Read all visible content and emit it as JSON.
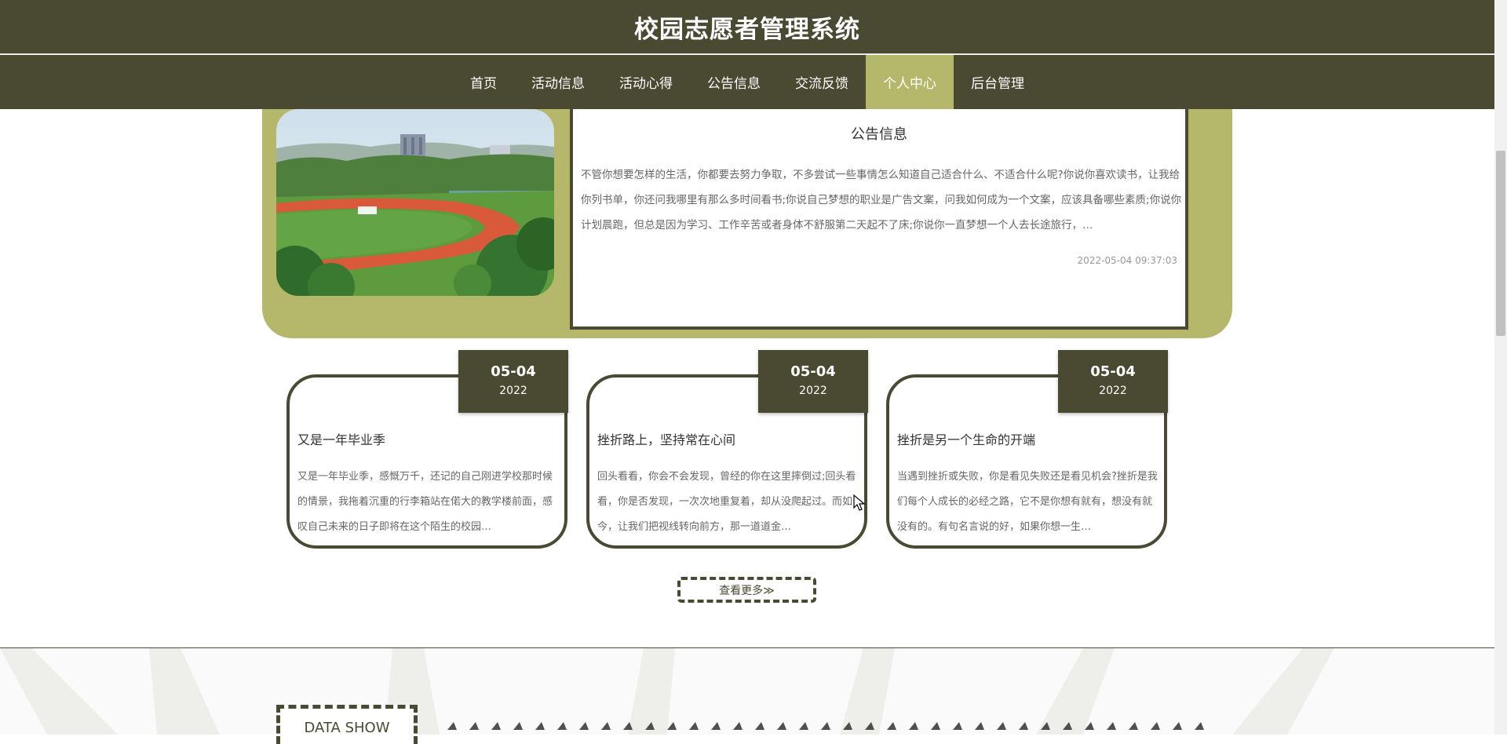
{
  "header": {
    "title": "校园志愿者管理系统"
  },
  "nav": {
    "items": [
      {
        "label": "首页"
      },
      {
        "label": "活动信息"
      },
      {
        "label": "活动心得"
      },
      {
        "label": "公告信息"
      },
      {
        "label": "交流反馈"
      },
      {
        "label": "个人中心",
        "active": true
      },
      {
        "label": "后台管理"
      }
    ]
  },
  "notice": {
    "title": "公告信息",
    "body": "不管你想要怎样的生活，你都要去努力争取，不多尝试一些事情怎么知道自己适合什么、不适合什么呢?你说你喜欢读书，让我给你列书单，你还问我哪里有那么多时间看书;你说自己梦想的职业是广告文案，问我如何成为一个文案，应该具备哪些素质;你说你计划晨跑，但总是因为学习、工作辛苦或者身体不舒服第二天起不了床;你说你一直梦想一个人去长途旅行，…",
    "date": "2022-05-04 09:37:03",
    "image": "campus-sports-field-photo"
  },
  "articles": [
    {
      "date_md": "05-04",
      "year": "2022",
      "title": "又是一年毕业季",
      "excerpt": "又是一年毕业季，感慨万千，还记的自己刚进学校那时候的情景，我拖着沉重的行李箱站在偌大的教学楼前面，感叹自己未来的日子即将在这个陌生的校园…"
    },
    {
      "date_md": "05-04",
      "year": "2022",
      "title": "挫折路上，坚持常在心间",
      "excerpt": "回头看看，你会不会发现，曾经的你在这里摔倒过;回头看看，你是否发现，一次次地重复着，却从没爬起过。而如今，让我们把视线转向前方，那一道道金…"
    },
    {
      "date_md": "05-04",
      "year": "2022",
      "title": "挫折是另一个生命的开端",
      "excerpt": "当遇到挫折或失败，你是看见失败还是看见机会?挫折是我们每个人成长的必经之路，它不是你想有就有，想没有就没有的。有句名言说的好，如果你想一生…"
    }
  ],
  "more_button": {
    "label": "查看更多≫"
  },
  "data_show": {
    "label": "DATA SHOW"
  },
  "colors": {
    "primary": "#4a4a33",
    "accent": "#b5b86a"
  }
}
